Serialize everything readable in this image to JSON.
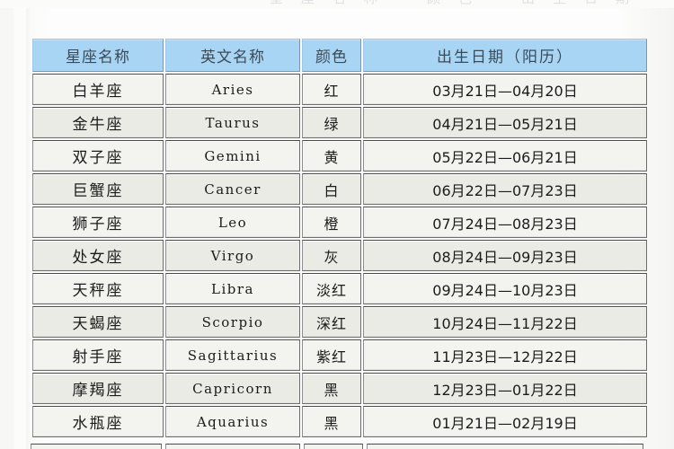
{
  "page": {
    "top_cut_off_text": "星座名称　颜色　出生日期"
  },
  "table": {
    "headers": {
      "name": "星座名称",
      "english": "英文名称",
      "color": "颜色",
      "date": "出生日期（阳历）"
    },
    "rows": [
      {
        "name": "白羊座",
        "english": "Aries",
        "color": "红",
        "date": "03月21日—04月20日"
      },
      {
        "name": "金牛座",
        "english": "Taurus",
        "color": "绿",
        "date": "04月21日—05月21日"
      },
      {
        "name": "双子座",
        "english": "Gemini",
        "color": "黄",
        "date": "05月22日—06月21日"
      },
      {
        "name": "巨蟹座",
        "english": "Cancer",
        "color": "白",
        "date": "06月22日—07月23日"
      },
      {
        "name": "狮子座",
        "english": "Leo",
        "color": "橙",
        "date": "07月24日—08月23日"
      },
      {
        "name": "处女座",
        "english": "Virgo",
        "color": "灰",
        "date": "08月24日—09月23日"
      },
      {
        "name": "天秤座",
        "english": "Libra",
        "color": "淡红",
        "date": "09月24日—10月23日"
      },
      {
        "name": "天蝎座",
        "english": "Scorpio",
        "color": "深红",
        "date": "10月24日—11月22日"
      },
      {
        "name": "射手座",
        "english": "Sagittarius",
        "color": "紫红",
        "date": "11月23日—12月22日"
      },
      {
        "name": "摩羯座",
        "english": "Capricorn",
        "color": "黑",
        "date": "12月23日—01月22日"
      },
      {
        "name": "水瓶座",
        "english": "Aquarius",
        "color": "黑",
        "date": "01月21日—02月19日"
      }
    ]
  },
  "colors": {
    "header_fill": "#a9d5f4",
    "header_border": "#5f9fd0",
    "row_fill": "#f3f3ef",
    "row_alt_fill": "#ebebe6",
    "cell_border": "#6d6d6d",
    "text": "#1b1b1b",
    "page_background": "#fdfdfd"
  }
}
